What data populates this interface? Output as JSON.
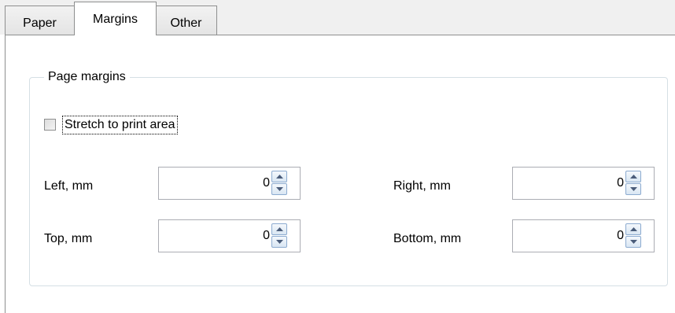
{
  "tabs": [
    {
      "label": "Paper",
      "active": false
    },
    {
      "label": "Margins",
      "active": true
    },
    {
      "label": "Other",
      "active": false
    }
  ],
  "group": {
    "title": "Page margins",
    "stretch": {
      "label": "Stretch to print area",
      "checked": false
    },
    "fields": {
      "left": {
        "label": "Left, mm",
        "value": "0"
      },
      "right": {
        "label": "Right, mm",
        "value": "0"
      },
      "top": {
        "label": "Top, mm",
        "value": "0"
      },
      "bottom": {
        "label": "Bottom, mm",
        "value": "0"
      }
    }
  },
  "icons": {
    "spin_up": "arrow-up-icon",
    "spin_down": "arrow-down-icon"
  },
  "colors": {
    "border": "#8e8f8f",
    "group_border": "#d5dfe5",
    "spin_button_border": "#8cabd0",
    "arrow": "#4a5c7a"
  }
}
